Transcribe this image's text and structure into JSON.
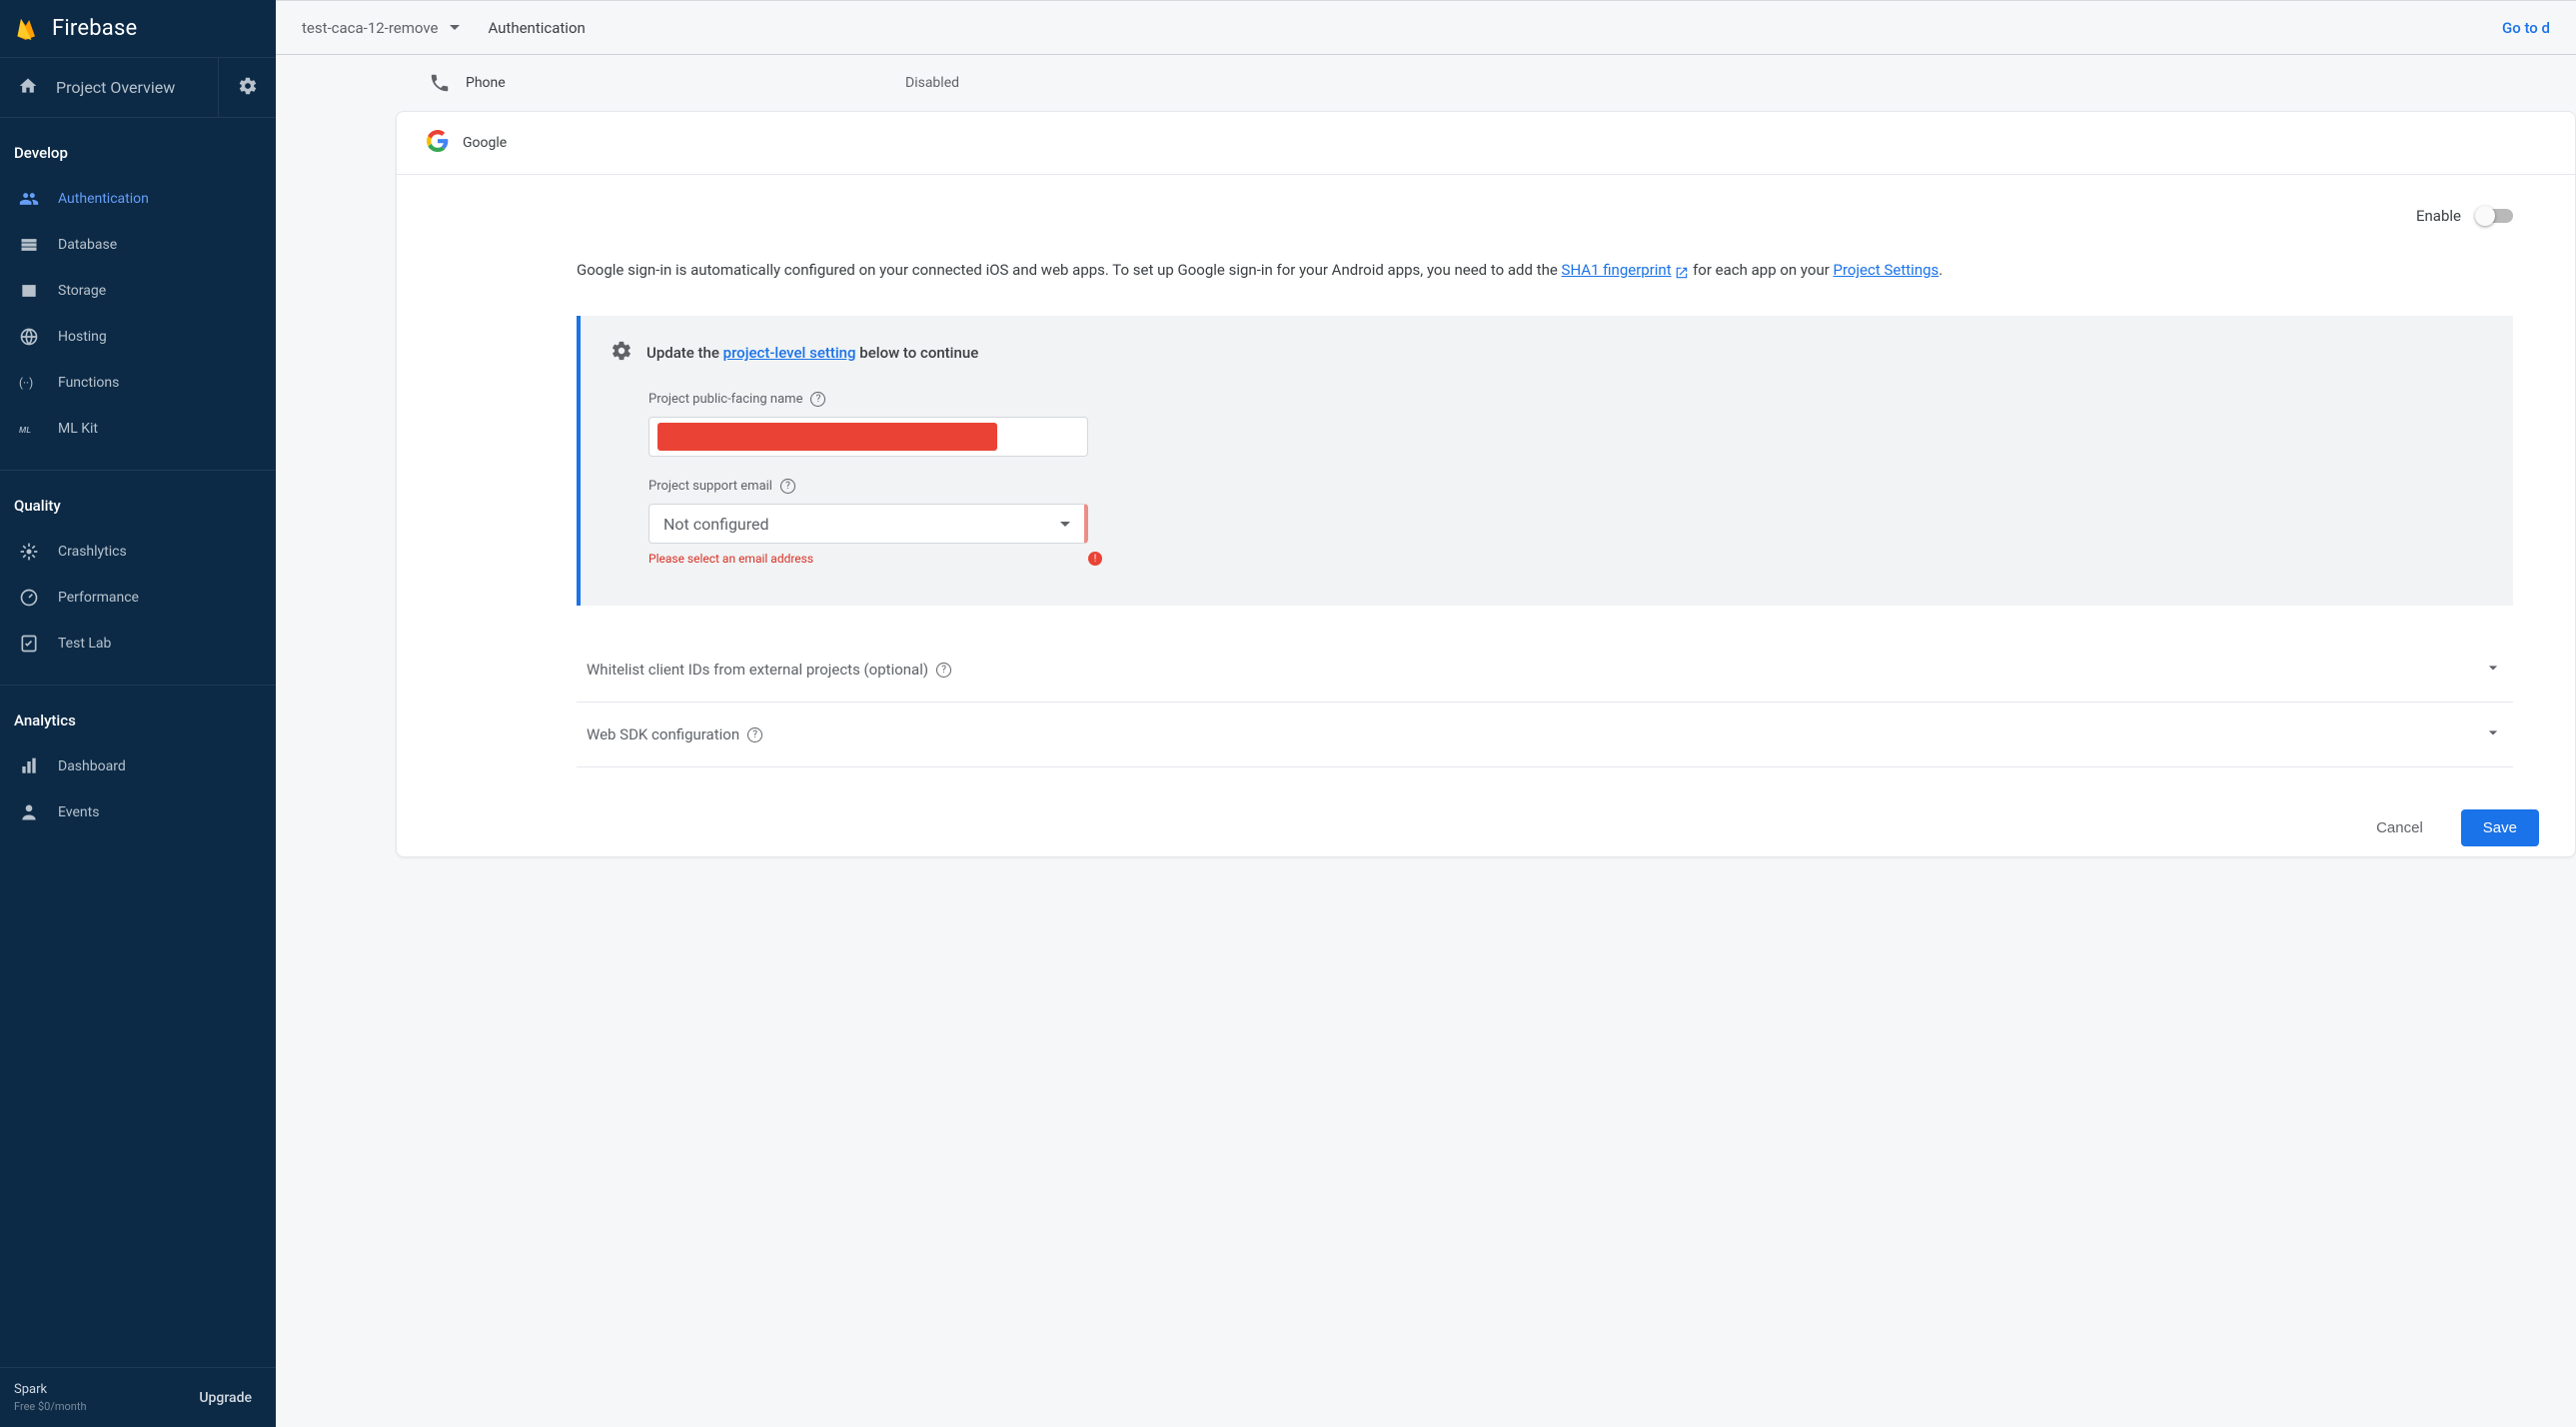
{
  "brand": "Firebase",
  "overview": {
    "label": "Project Overview"
  },
  "sections": {
    "develop": {
      "title": "Develop",
      "items": [
        {
          "label": "Authentication",
          "active": true
        },
        {
          "label": "Database"
        },
        {
          "label": "Storage"
        },
        {
          "label": "Hosting"
        },
        {
          "label": "Functions"
        },
        {
          "label": "ML Kit"
        }
      ]
    },
    "quality": {
      "title": "Quality",
      "items": [
        {
          "label": "Crashlytics"
        },
        {
          "label": "Performance"
        },
        {
          "label": "Test Lab"
        }
      ]
    },
    "analytics": {
      "title": "Analytics",
      "items": [
        {
          "label": "Dashboard"
        },
        {
          "label": "Events"
        }
      ]
    }
  },
  "plan": {
    "name": "Spark",
    "price": "Free $0/month",
    "upgrade": "Upgrade"
  },
  "topbar": {
    "project": "test-caca-12-remove",
    "crumb": "Authentication",
    "docs": "Go to d"
  },
  "providers": {
    "phone": {
      "name": "Phone",
      "status": "Disabled"
    },
    "google": {
      "name": "Google",
      "enable_label": "Enable",
      "enabled": false,
      "intro": {
        "prefix": "Google sign-in is automatically configured on your connected iOS and web apps. To set up Google sign-in for your Android apps, you need to add the ",
        "link1": "SHA1 fingerprint",
        "mid": " for each app on your ",
        "link2": "Project Settings",
        "suffix": "."
      },
      "setting": {
        "title_pre": "Update the ",
        "title_link": "project-level setting",
        "title_post": " below to continue",
        "public_name_label": "Project public-facing name",
        "support_email_label": "Project support email",
        "support_email_value": "Not configured",
        "support_email_error": "Please select an email address"
      },
      "expanders": [
        {
          "label": "Whitelist client IDs from external projects (optional)"
        },
        {
          "label": "Web SDK configuration"
        }
      ],
      "actions": {
        "cancel": "Cancel",
        "save": "Save"
      }
    }
  }
}
